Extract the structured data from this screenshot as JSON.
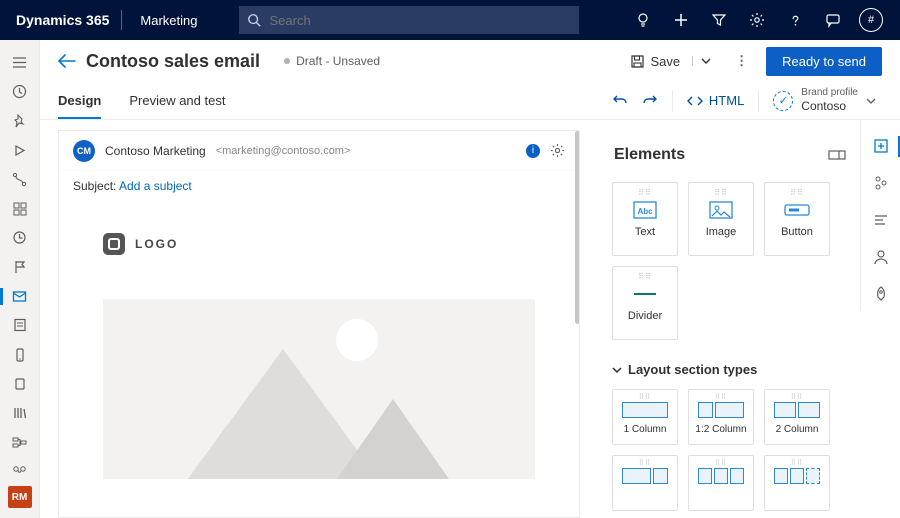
{
  "topbar": {
    "brand": "Dynamics 365",
    "module": "Marketing",
    "search_placeholder": "Search",
    "avatar_initial": "#"
  },
  "leftrail": {
    "user_badge": "RM"
  },
  "cmdbar": {
    "title": "Contoso sales email",
    "status": "Draft - Unsaved",
    "save": "Save",
    "primary": "Ready to send"
  },
  "tabs": {
    "design": "Design",
    "preview": "Preview and test",
    "html": "HTML",
    "brand_profile_label": "Brand profile",
    "brand_profile_value": "Contoso"
  },
  "sender": {
    "initials": "CM",
    "name": "Contoso Marketing",
    "email": "<marketing@contoso.com>",
    "subject_label": "Subject:",
    "subject_link": "Add a subject"
  },
  "canvas": {
    "logo_text": "LOGO"
  },
  "elements": {
    "title": "Elements",
    "items": {
      "text": "Text",
      "image": "Image",
      "button": "Button",
      "divider": "Divider"
    },
    "layout_header": "Layout section types",
    "layouts": {
      "c1": "1 Column",
      "c12": "1:2 Column",
      "c2": "2 Column"
    }
  }
}
